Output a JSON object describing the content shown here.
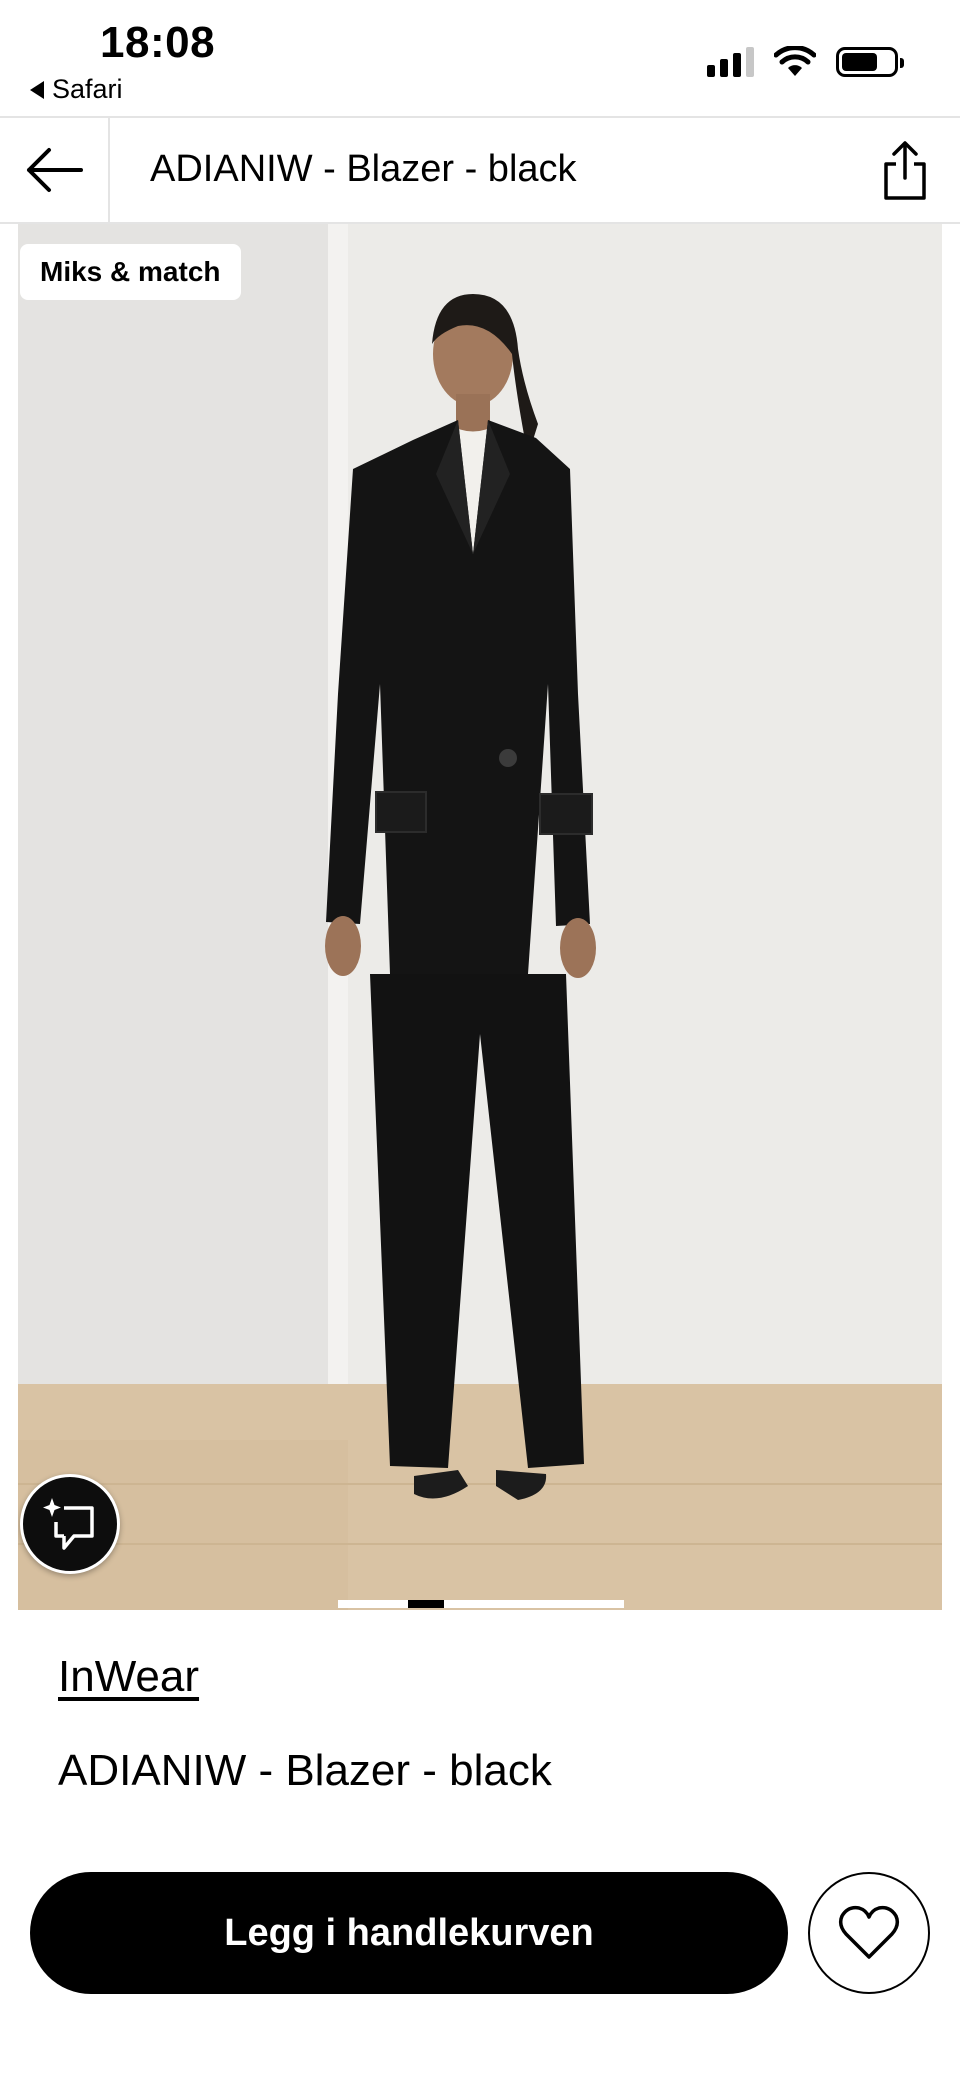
{
  "status_bar": {
    "time": "18:08",
    "back_app": "Safari",
    "icons": [
      "signal-icon",
      "wifi-icon",
      "battery-icon"
    ]
  },
  "header": {
    "title": "ADIANIW - Blazer - black",
    "back_icon": "arrow-left-icon",
    "share_icon": "share-icon"
  },
  "gallery": {
    "badge": "Miks & match",
    "image_description_icon": "model-photo",
    "ai_button_icon": "sparkle-chat-icon"
  },
  "product": {
    "brand": "InWear",
    "name": "ADIANIW - Blazer - black"
  },
  "actions": {
    "add_to_cart": "Legg i handlekurven",
    "wishlist_icon": "heart-icon"
  }
}
